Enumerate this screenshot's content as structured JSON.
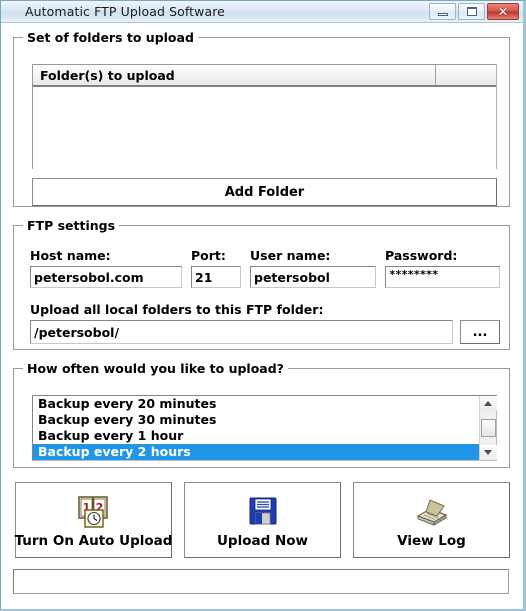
{
  "window": {
    "title": "Automatic FTP Upload Software",
    "caption_buttons": {
      "minimize_name": "minimize",
      "maximize_name": "maximize",
      "close_glyph": "✕"
    }
  },
  "folders_group": {
    "title": "Set of folders to upload",
    "columns": [
      "Folder(s) to upload",
      ""
    ],
    "rows": [],
    "add_folder_label": "Add Folder"
  },
  "ftp_group": {
    "title": "FTP settings",
    "fields": [
      {
        "label": "Host name:",
        "value": "petersobol.com",
        "placeholder": ""
      },
      {
        "label": "Port:",
        "value": "21",
        "placeholder": ""
      },
      {
        "label": "User name:",
        "value": "petersobol",
        "placeholder": ""
      },
      {
        "label": "Password:",
        "value": "********",
        "placeholder": ""
      }
    ],
    "remote_folder_label": "Upload all local folders to this FTP folder:",
    "remote_folder_value": "/petersobol/",
    "browse_label": "..."
  },
  "schedule_group": {
    "title": "How often would you like to upload?",
    "items": [
      {
        "label": "Backup every 20 minutes",
        "selected": false
      },
      {
        "label": "Backup every 30 minutes",
        "selected": false
      },
      {
        "label": "Backup every 1 hour",
        "selected": false
      },
      {
        "label": "Backup every 2 hours",
        "selected": true
      }
    ],
    "selection_color": "#2196e8"
  },
  "actions": [
    {
      "label": "Turn On Auto Upload",
      "icon": "schedule-clock-icon"
    },
    {
      "label": "Upload Now",
      "icon": "floppy-disk-icon"
    },
    {
      "label": "View Log",
      "icon": "open-book-icon"
    }
  ],
  "status_bar": {
    "text": ""
  }
}
